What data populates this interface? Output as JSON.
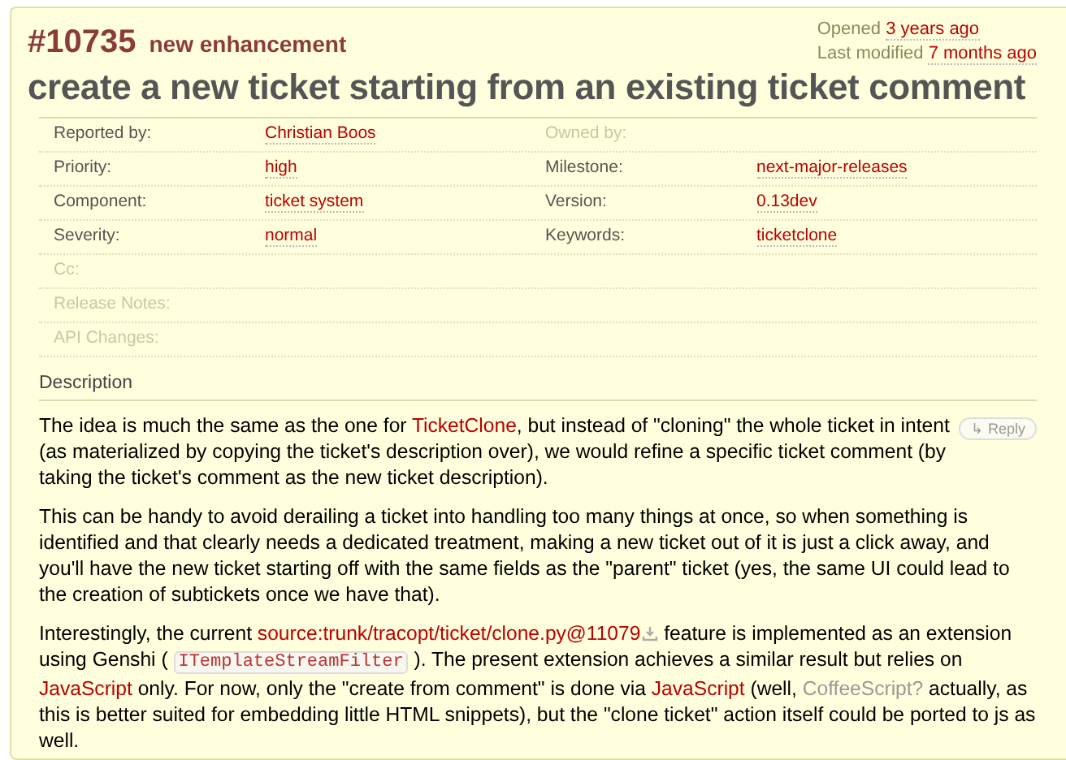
{
  "ticket": {
    "number": "#10735",
    "type": "new enhancement",
    "opened_label": "Opened",
    "opened": "3 years ago",
    "modified_label": "Last modified",
    "modified": "7 months ago",
    "title": "create a new ticket starting from an existing ticket comment"
  },
  "properties": [
    [
      {
        "label": "Reported by:",
        "value": "Christian Boos"
      },
      {
        "label": "Owned by:"
      }
    ],
    [
      {
        "label": "Priority:",
        "value": "high"
      },
      {
        "label": "Milestone:",
        "value": "next-major-releases"
      }
    ],
    [
      {
        "label": "Component:",
        "value": "ticket system"
      },
      {
        "label": "Version:",
        "value": "0.13dev"
      }
    ],
    [
      {
        "label": "Severity:",
        "value": "normal"
      },
      {
        "label": "Keywords:",
        "value": "ticketclone"
      }
    ],
    [
      {
        "label": "Cc:"
      }
    ],
    [
      {
        "label": "Release Notes:"
      }
    ],
    [
      {
        "label": "API Changes:"
      }
    ]
  ],
  "description": {
    "heading": "Description",
    "reply": "↳ Reply",
    "paragraphs": [
      [
        {
          "kind": "text",
          "text": "The idea is much the same as the one for "
        },
        {
          "kind": "link",
          "text": "TicketClone"
        },
        {
          "kind": "text",
          "text": ", but instead of \"cloning\" the whole ticket in intent (as materialized by copying the ticket's description over), we would refine a specific ticket comment (by taking the ticket's comment as the new ticket description)."
        }
      ],
      [
        {
          "kind": "text",
          "text": "This can be handy to avoid derailing a ticket into handling too many things at once, so when something is identified and that clearly needs a dedicated treatment, making a new ticket out of it is just a click away, and you'll have the new ticket starting off with the same fields as the \"parent\" ticket (yes, the same UI could lead to the creation of subtickets once we have that)."
        }
      ],
      [
        {
          "kind": "text",
          "text": "Interestingly, the current "
        },
        {
          "kind": "link",
          "text": "source:trunk/tracopt/ticket/clone.py@11079"
        },
        {
          "kind": "download"
        },
        {
          "kind": "text",
          "text": " feature is implemented as an extension using Genshi ( "
        },
        {
          "kind": "code",
          "text": "ITemplateStreamFilter"
        },
        {
          "kind": "text",
          "text": " ). The present extension achieves a similar result but relies on "
        },
        {
          "kind": "link",
          "text": "JavaScript"
        },
        {
          "kind": "text",
          "text": " only. For now, only the \"create from comment\" is done via "
        },
        {
          "kind": "link",
          "text": "JavaScript"
        },
        {
          "kind": "text",
          "text": " (well, "
        },
        {
          "kind": "missing",
          "text": "CoffeeScript?"
        },
        {
          "kind": "text",
          "text": " actually, as this is better suited for embedding little HTML snippets), but the \"clone ticket\" action itself could be ported to js as well."
        }
      ]
    ]
  }
}
